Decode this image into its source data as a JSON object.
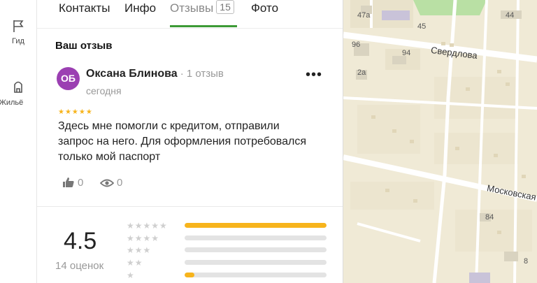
{
  "rail": {
    "items": [
      {
        "label": "Гид",
        "icon": "flag-icon"
      },
      {
        "label": "Жильё",
        "icon": "building-icon"
      }
    ]
  },
  "tabs": [
    {
      "label": "Контакты"
    },
    {
      "label": "Инфо"
    },
    {
      "label": "Отзывы",
      "count": "15",
      "active": true
    },
    {
      "label": "Фото"
    }
  ],
  "review": {
    "section_title": "Ваш отзыв",
    "avatar_initials": "ОБ",
    "author": "Оксана Блинова",
    "author_reviews": "· 1 отзыв",
    "date": "сегодня",
    "stars": "★★★★★",
    "text": "Здесь мне помогли с кредитом, отправили запрос на него. Для оформления потребовался только мой паспорт",
    "likes": "0",
    "views": "0",
    "more_label": "•••"
  },
  "rating": {
    "value": "4.5",
    "count_label": "14 оценок",
    "breakdown": [
      {
        "stars": "★★★★★",
        "fill": 1.0
      },
      {
        "stars": "★★★★",
        "fill": 0.0
      },
      {
        "stars": "★★★",
        "fill": 0.0
      },
      {
        "stars": "★★",
        "fill": 0.0
      },
      {
        "stars": "★",
        "fill": 0.07
      }
    ]
  },
  "map": {
    "streets": [
      "Свердлова",
      "Московская"
    ],
    "house_numbers": [
      "47а",
      "45",
      "44",
      "96",
      "94",
      "2а",
      "84",
      "8"
    ],
    "colors": {
      "land": "#f0ead6",
      "road": "#ffffff",
      "building": "#d9d3c0",
      "green": "#b9e0a4",
      "accent": "#3c9a36",
      "star": "#f7b41c"
    }
  }
}
